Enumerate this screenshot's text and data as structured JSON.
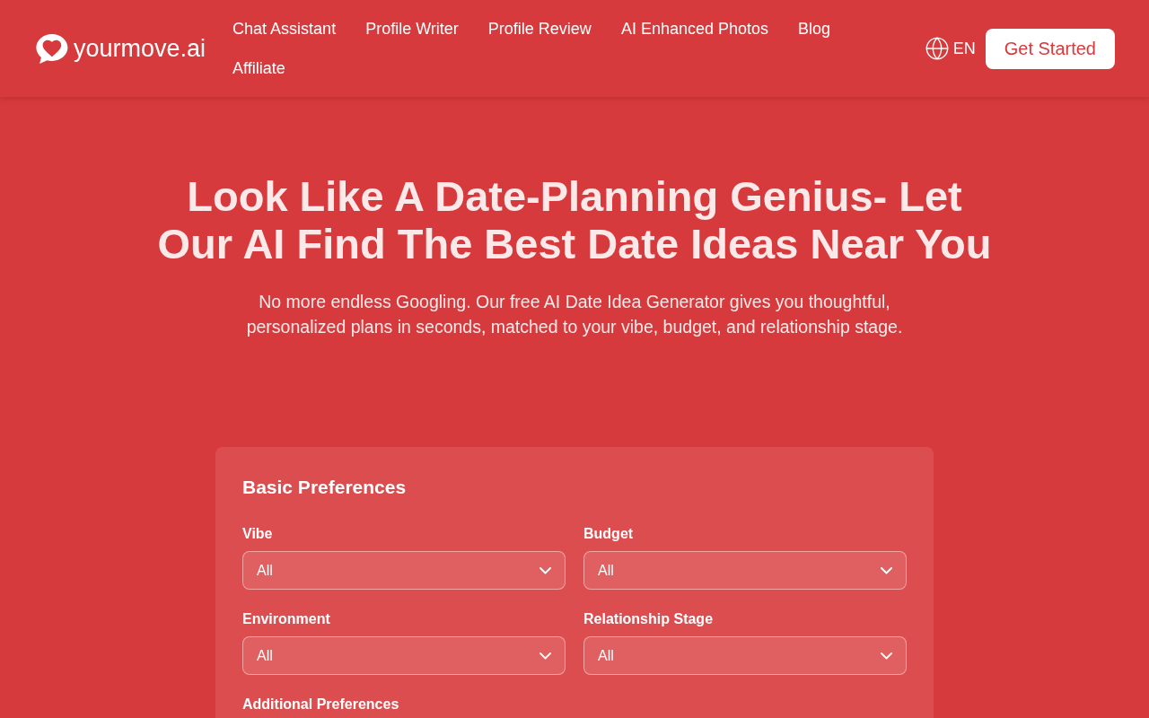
{
  "header": {
    "logo": "yourmove.ai",
    "nav": [
      "Chat Assistant",
      "Profile Writer",
      "Profile Review",
      "AI Enhanced Photos",
      "Blog",
      "Affiliate"
    ],
    "language": "EN",
    "cta": "Get Started"
  },
  "hero": {
    "title": "Look Like A Date-Planning Genius- Let Our AI Find The Best Date Ideas Near You",
    "subtitle": "No more endless Googling. Our free AI Date Idea Generator gives you thoughtful, personalized plans in seconds, matched to your vibe, budget, and relationship stage."
  },
  "form": {
    "section_title": "Basic Preferences",
    "fields": [
      {
        "label": "Vibe",
        "value": "All"
      },
      {
        "label": "Budget",
        "value": "All"
      },
      {
        "label": "Environment",
        "value": "All"
      },
      {
        "label": "Relationship Stage",
        "value": "All"
      }
    ],
    "next_section_title": "Additional Preferences"
  }
}
